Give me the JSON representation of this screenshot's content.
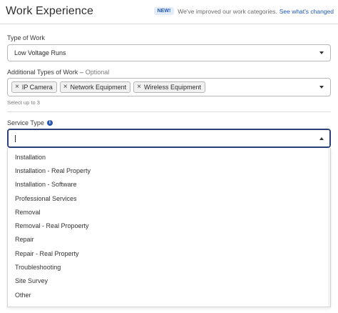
{
  "header": {
    "title": "Work Experience",
    "badge": "NEW!",
    "notice_text": "We've improved our work categories.",
    "notice_link": "See what's changed"
  },
  "type_of_work": {
    "label": "Type of Work",
    "value": "Low Voltage Runs"
  },
  "additional_types": {
    "label": "Additional Types of Work –",
    "optional": "Optional",
    "chips": [
      "IP Camera",
      "Network Equipment",
      "Wireless Equipment"
    ],
    "helper": "Select up to 3"
  },
  "service_type": {
    "label": "Service Type",
    "value": "",
    "options": [
      "Installation",
      "Installation - Real Property",
      "Installation - Software",
      "Professional Services",
      "Removal",
      "Removal - Real Propoerty",
      "Repair",
      "Repair - Real Property",
      "Troubleshooting",
      "Site Survey",
      "Other"
    ]
  },
  "colors": {
    "accent": "#1f57b8",
    "badge_bg": "#e3ecfa",
    "active_border": "#2a3f7a",
    "info_icon": "#2856b0"
  },
  "icons": {
    "chip_remove": "close-icon",
    "dropdown": "chevron-down-icon",
    "dropdown_open": "chevron-up-icon",
    "info": "info-icon"
  }
}
